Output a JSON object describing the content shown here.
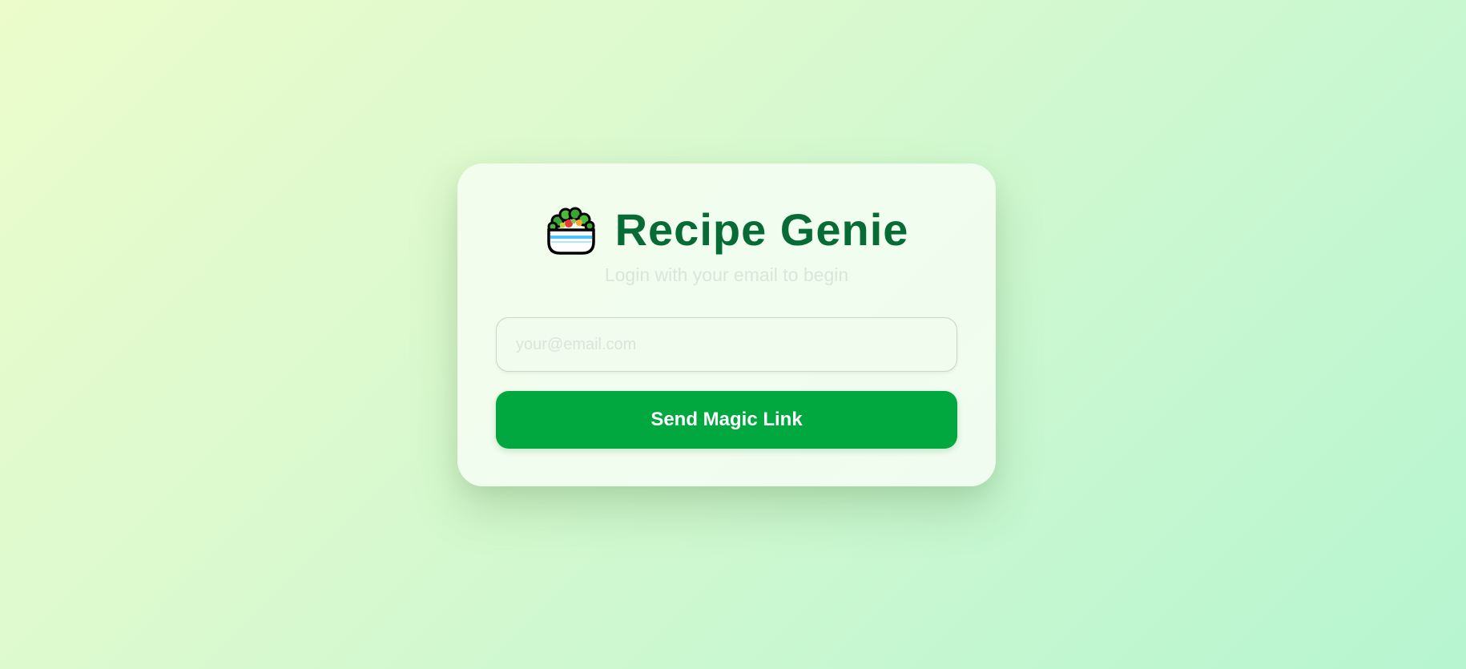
{
  "app": {
    "title": "Recipe Genie",
    "logo_icon": "salad-bowl-icon"
  },
  "login": {
    "subtitle": "Login with your email to begin",
    "email_placeholder": "your@email.com",
    "email_value": "",
    "submit_label": "Send Magic Link"
  },
  "colors": {
    "title": "#066b35",
    "button": "#00a83f",
    "button_text": "#ffffff",
    "background_start": "#ecfccb",
    "background_end": "#b6f5d0"
  }
}
